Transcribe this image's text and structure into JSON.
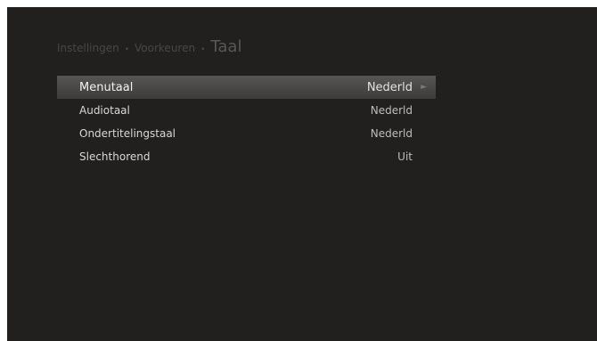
{
  "breadcrumb": {
    "items": [
      "Instellingen",
      "Voorkeuren"
    ],
    "separator": "•",
    "current": "Taal"
  },
  "menu": {
    "selected_index": 0,
    "items": [
      {
        "label": "Menutaal",
        "value": "Nederld"
      },
      {
        "label": "Audiotaal",
        "value": "Nederld"
      },
      {
        "label": "Ondertitelingstaal",
        "value": "Nederld"
      },
      {
        "label": "Slechthorend",
        "value": "Uit"
      }
    ]
  },
  "colors": {
    "background": "#221f1f",
    "highlight": "#4b4848",
    "breadcrumb_text": "#4a4646"
  },
  "icons": {
    "selected_row_arrow": "chevron-right-icon"
  }
}
